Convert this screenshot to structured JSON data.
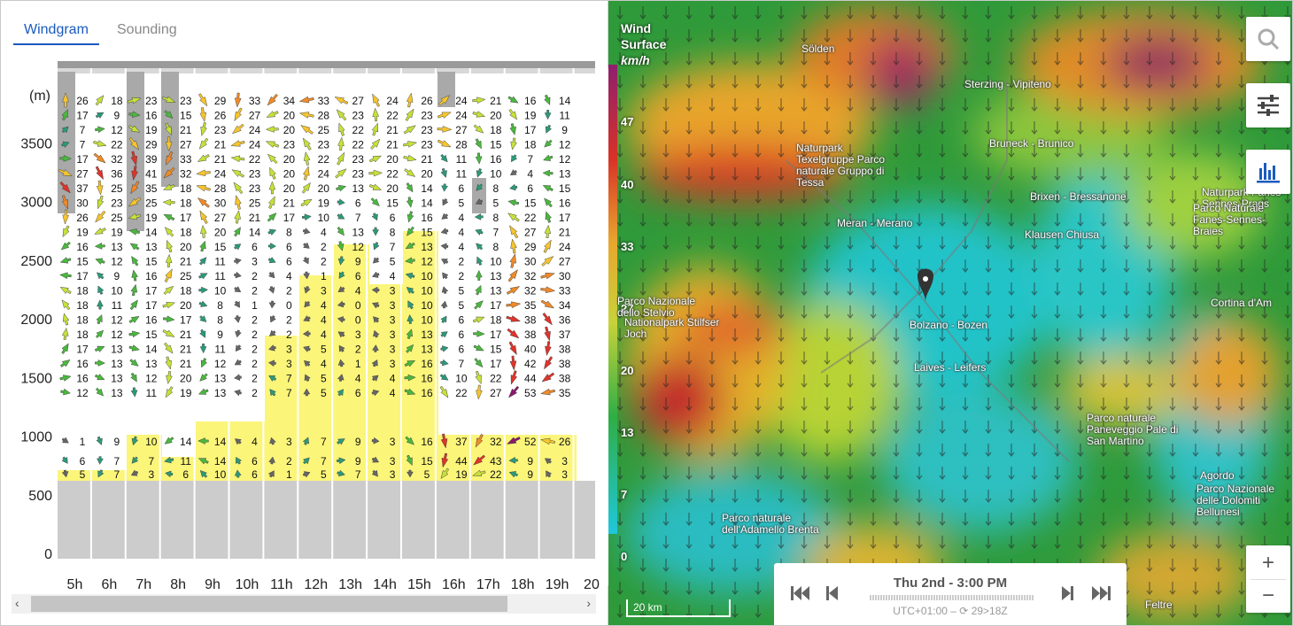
{
  "tabs": [
    {
      "label": "Windgram",
      "active": true
    },
    {
      "label": "Sounding",
      "active": false
    }
  ],
  "windgram": {
    "y_unit": "(m)",
    "y_ticks": [
      {
        "label": "3500",
        "v": 3500
      },
      {
        "label": "3000",
        "v": 3000
      },
      {
        "label": "2500",
        "v": 2500
      },
      {
        "label": "2000",
        "v": 2000
      },
      {
        "label": "1500",
        "v": 1500
      },
      {
        "label": "1000",
        "v": 1000
      },
      {
        "label": "500",
        "v": 500
      },
      {
        "label": "0",
        "v": 0
      }
    ],
    "hours": [
      "5h",
      "6h",
      "7h",
      "8h",
      "9h",
      "10h",
      "11h",
      "12h",
      "13h",
      "14h",
      "15h",
      "16h",
      "17h",
      "18h",
      "19h",
      "20"
    ],
    "columns": [
      [
        26,
        17,
        7,
        7,
        17,
        27,
        37,
        30,
        26,
        19,
        16,
        15,
        17,
        18,
        18,
        18,
        18,
        17,
        16,
        16,
        12,
        1,
        6,
        5
      ],
      [
        18,
        9,
        12,
        22,
        32,
        36,
        25,
        23,
        25,
        19,
        13,
        12,
        9,
        10,
        11,
        12,
        12,
        13,
        13,
        13,
        13,
        9,
        7,
        7
      ],
      [
        23,
        16,
        19,
        29,
        39,
        41,
        35,
        25,
        19,
        14,
        13,
        15,
        16,
        17,
        17,
        16,
        15,
        14,
        13,
        12,
        11,
        10,
        7,
        3
      ],
      [
        23,
        15,
        21,
        27,
        33,
        32,
        18,
        18,
        17,
        18,
        20,
        21,
        25,
        18,
        20,
        17,
        21,
        21,
        21,
        20,
        19,
        14,
        11,
        6
      ],
      [
        29,
        26,
        23,
        21,
        21,
        24,
        28,
        30,
        27,
        20,
        15,
        11,
        11,
        10,
        8,
        8,
        9,
        11,
        12,
        13,
        13,
        14,
        14,
        10
      ],
      [
        33,
        27,
        24,
        24,
        22,
        23,
        23,
        25,
        21,
        14,
        6,
        3,
        2,
        2,
        1,
        2,
        2,
        2,
        2,
        2,
        2,
        4,
        6,
        6
      ],
      [
        34,
        20,
        20,
        23,
        20,
        20,
        20,
        21,
        17,
        8,
        6,
        6,
        4,
        2,
        0,
        2,
        2,
        3,
        3,
        7,
        7,
        3,
        2,
        1
      ],
      [
        33,
        28,
        25,
        23,
        22,
        24,
        20,
        19,
        10,
        4,
        2,
        2,
        1,
        3,
        4,
        4,
        4,
        5,
        4,
        5,
        5,
        7,
        7,
        5
      ],
      [
        27,
        23,
        22,
        22,
        23,
        23,
        13,
        6,
        7,
        13,
        12,
        9,
        6,
        4,
        0,
        0,
        3,
        2,
        1,
        4,
        6,
        9,
        9,
        7
      ],
      [
        24,
        22,
        21,
        21,
        20,
        22,
        20,
        15,
        6,
        8,
        7,
        5,
        4,
        3,
        3,
        3,
        3,
        3,
        3,
        4,
        4,
        3,
        3,
        3
      ],
      [
        26,
        23,
        23,
        23,
        21,
        20,
        14,
        14,
        16,
        15,
        13,
        12,
        10,
        10,
        10,
        10,
        13,
        13,
        16,
        16,
        16,
        16,
        15,
        5
      ],
      [
        24,
        24,
        27,
        28,
        11,
        11,
        6,
        5,
        4,
        4,
        4,
        2,
        2,
        5,
        5,
        6,
        6,
        6,
        7,
        10,
        22,
        37,
        44,
        19
      ],
      [
        21,
        20,
        18,
        15,
        16,
        10,
        8,
        5,
        8,
        7,
        8,
        10,
        13,
        13,
        17,
        18,
        17,
        15,
        17,
        22,
        27,
        32,
        43,
        22
      ],
      [
        16,
        19,
        17,
        18,
        7,
        4,
        6,
        15,
        22,
        27,
        29,
        30,
        32,
        32,
        35,
        38,
        38,
        40,
        42,
        44,
        53,
        52,
        9,
        9
      ],
      [
        14,
        11,
        9,
        12,
        12,
        13,
        15,
        16,
        17,
        21,
        24,
        27,
        30,
        33,
        34,
        36,
        37,
        38,
        38,
        38,
        35,
        26,
        3,
        3
      ]
    ]
  },
  "map": {
    "legend": {
      "title1": "Wind",
      "title2": "Surface",
      "unit": "km/h",
      "ticks": [
        "47",
        "40",
        "33",
        "27",
        "20",
        "13",
        "7",
        "0"
      ]
    },
    "places": [
      "Sölden",
      "Sterzing - Vipiteno",
      "Bruneck - Brunico",
      "Naturpark Texelgruppe Parco naturale Gruppo di Tessa",
      "Meran - Merano",
      "Brixen - Bressanone",
      "Naturpark Fanes-Sennes-Prags",
      "Parco Naturale Fanes-Sennes-Braies",
      "Klausen Chiusa",
      "Bolzano - Bozen",
      "Laives - Leifers",
      "Parco Nazionale dello Stelvio",
      "Nationalpark Stilfser Joch",
      "Cortina d'Am",
      "Parco naturale Paneveggio Pale di San Martino",
      "Agordo",
      "Parco Nazionale delle Dolomiti Bellunesi",
      "Parco naturale dell'Adamello Brenta",
      "Feltre"
    ],
    "scale": "20 km",
    "time": "Thu 2nd - 3:00 PM",
    "tz": "UTC+01:00 – ⟳ 29>18Z"
  }
}
